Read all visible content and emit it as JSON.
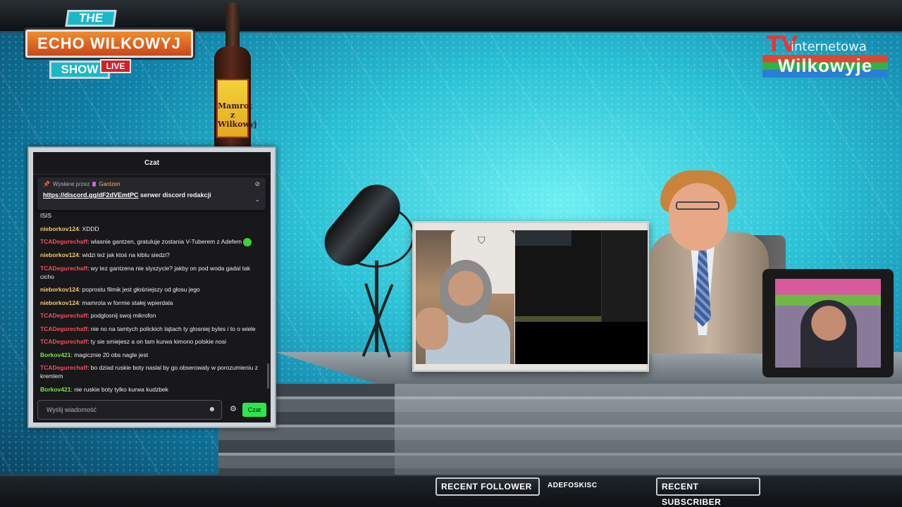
{
  "logo": {
    "the": "THE",
    "main": "ECHO WILKOWYJ",
    "show": "SHOW",
    "live": "LIVE"
  },
  "bottle": {
    "label": "Mamrot z Wilkowyj"
  },
  "tv_logo": {
    "tv": "TV",
    "net": "internetowa",
    "name": "Wilkowyje"
  },
  "chat": {
    "title": "Czat",
    "pinned": {
      "by_label": "Wysłane przez",
      "by_name": "Gantzen",
      "link": "https://discord.gg/dF2dVEmtPC",
      "text": " serwer discord redakcji"
    },
    "messages": [
      {
        "user": "",
        "text": "ISIS",
        "color": "#efeff1"
      },
      {
        "user": "nieborkov124",
        "text": ": XDDD",
        "color": "#f5c86a"
      },
      {
        "user": "TCADegurechaff",
        "text": ": wlasnie gantzen, gratuluje zostania V-Tuberem z Adefem",
        "color": "#ff4a5a",
        "emote": true
      },
      {
        "user": "nieborkov124",
        "text": ": widzi też jak ktoś na kiblu siedzi?",
        "color": "#f5c86a"
      },
      {
        "user": "TCADegurechaff",
        "text": ": wy tez gantzena nie slyszycie? jakby on pod woda gadal tak cicho",
        "color": "#ff4a5a"
      },
      {
        "user": "nieborkov124",
        "text": ": poprostu filmik jest głośniejszy od głosu jego",
        "color": "#f5c86a"
      },
      {
        "user": "nieborkov124",
        "text": ": mamrota w formie stałej wpierdala",
        "color": "#f5c86a"
      },
      {
        "user": "TCADegurechaff",
        "text": ": podglosnij swoj mikrofon",
        "color": "#ff4a5a"
      },
      {
        "user": "TCADegurechaff",
        "text": ": nie no na tamtych polickich lajtach ty glosniej byles i to o wiele",
        "color": "#ff4a5a"
      },
      {
        "user": "TCADegurechaff",
        "text": ": ty sie smiejesz a on tam kurwa kimono polskie nosi",
        "color": "#ff4a5a"
      },
      {
        "user": "Borkov421",
        "text": ": magicznie 20 obs nagle jest",
        "color": "#7ee04a"
      },
      {
        "user": "TCADegurechaff",
        "text": ": bo dziad ruskie boty naslal by go obserowaly w porozumieniu z kremlem",
        "color": "#ff4a5a"
      },
      {
        "user": "Borkov421",
        "text": ": nie ruskie boty tylko kurwa kudzbek",
        "color": "#7ee04a"
      }
    ],
    "input_placeholder": "Wyślij wiadomość",
    "send_label": "Czat"
  },
  "bottom": {
    "recent_follower_label": "RECENT FOLLOWER",
    "recent_follower_name": "ADEFOSKISC",
    "recent_subscriber_label": "RECENT SUBSCRIBER"
  },
  "icons": {
    "pin": "pin-icon",
    "hide": "eye-slash-icon",
    "expand": "chevron-down-icon",
    "emoji": "smile-icon",
    "settings": "gear-icon"
  }
}
